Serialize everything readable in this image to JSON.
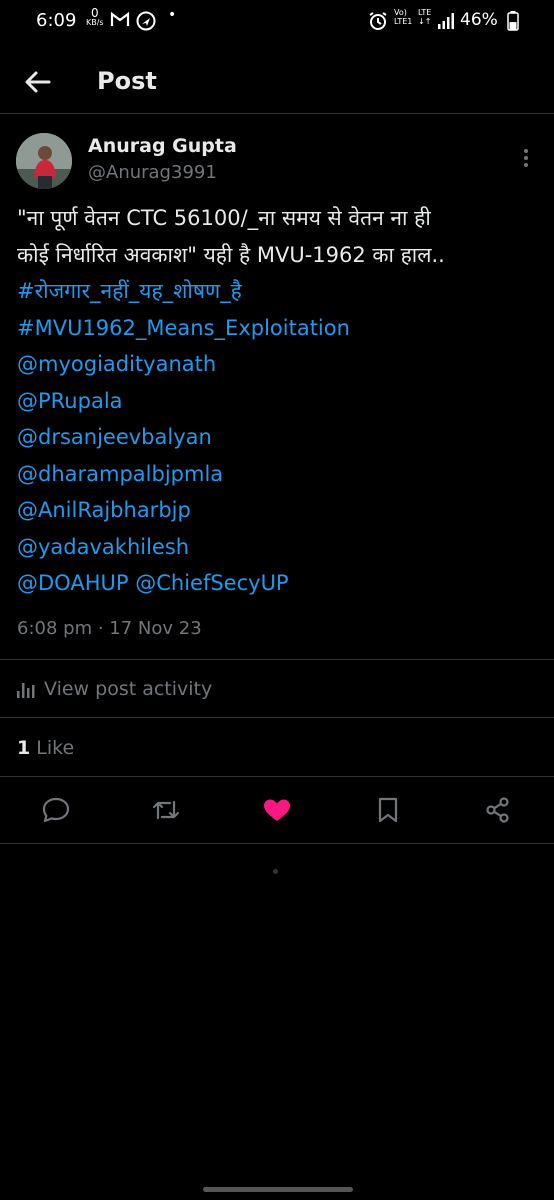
{
  "status_bar": {
    "time": "6:09",
    "net_speed_value": "0",
    "net_speed_unit": "KB/s",
    "volte_line1": "Vo)",
    "volte_line2": "LTE1",
    "lte_line1": "LTE",
    "lte_line2": "↓↑",
    "battery_text": "46%",
    "battery_level": 0.46,
    "notification_dot": "•"
  },
  "header": {
    "title": "Post"
  },
  "post": {
    "author_name": "Anurag Gupta",
    "author_handle": "@Anurag3991",
    "text_line1": "\"ना पूर्ण वेतन CTC 56100/_ना समय से वेतन ना ही",
    "text_line2": "कोई निर्धारित अवकाश\" यही है MVU-1962 का हाल..",
    "hashtag1": "#रोजगार_नहीं_यह_शोषण_है",
    "hashtag2": "#MVU1962_Means_Exploitation",
    "mention1": "@myogiadityanath",
    "mention2": "@PRupala",
    "mention3": "@drsanjeevbalyan",
    "mention4": "@dharampalbjpmla",
    "mention5": "@AnilRajbharbjp",
    "mention6": "@yadavakhilesh",
    "mention7": "@DOAHUP",
    "mention8": "@ChiefSecyUP",
    "timestamp": "6:08 pm · 17 Nov 23"
  },
  "activity": {
    "label": "View post activity"
  },
  "likes": {
    "count": "1",
    "label": "Like"
  },
  "colors": {
    "background": "#000000",
    "text_primary": "#e7e9ea",
    "text_secondary": "#71767b",
    "link": "#1d9bf0",
    "like_active": "#f91880",
    "divider": "#2f3336"
  },
  "icons": {
    "back": "arrow-left-icon",
    "more": "more-vertical-icon",
    "activity": "bar-chart-icon",
    "reply": "reply-icon",
    "repost": "repost-icon",
    "like": "heart-filled-icon",
    "bookmark": "bookmark-icon",
    "share": "share-icon"
  }
}
